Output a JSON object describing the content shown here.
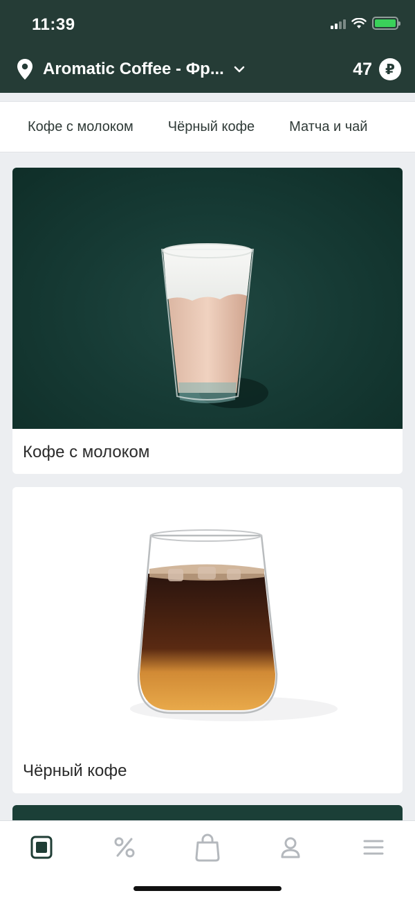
{
  "status_bar": {
    "time": "11:39"
  },
  "header": {
    "location_icon": "location-pin-icon",
    "location_text": "Aromatic Coffee - Фр...",
    "dropdown_icon": "chevron-down-icon",
    "balance_value": "47",
    "currency_symbol": "₽"
  },
  "tabs": [
    {
      "label": "Кофе с молоком"
    },
    {
      "label": "Чёрный кофе"
    },
    {
      "label": "Матча и чай"
    }
  ],
  "categories": [
    {
      "title": "Кофе с молоком",
      "image": "iced-latte-glass"
    },
    {
      "title": "Чёрный кофе",
      "image": "iced-black-coffee-glass"
    }
  ],
  "bottom_nav": [
    {
      "name": "menu",
      "icon": "menu-card-icon",
      "active": true
    },
    {
      "name": "offers",
      "icon": "percent-icon"
    },
    {
      "name": "cart",
      "icon": "shopping-bag-icon"
    },
    {
      "name": "profile",
      "icon": "profile-icon"
    },
    {
      "name": "more",
      "icon": "hamburger-icon"
    }
  ],
  "colors": {
    "brand": "#253c36",
    "active_icon": "#1f3d35",
    "inactive_icon": "#b4b8bd"
  }
}
